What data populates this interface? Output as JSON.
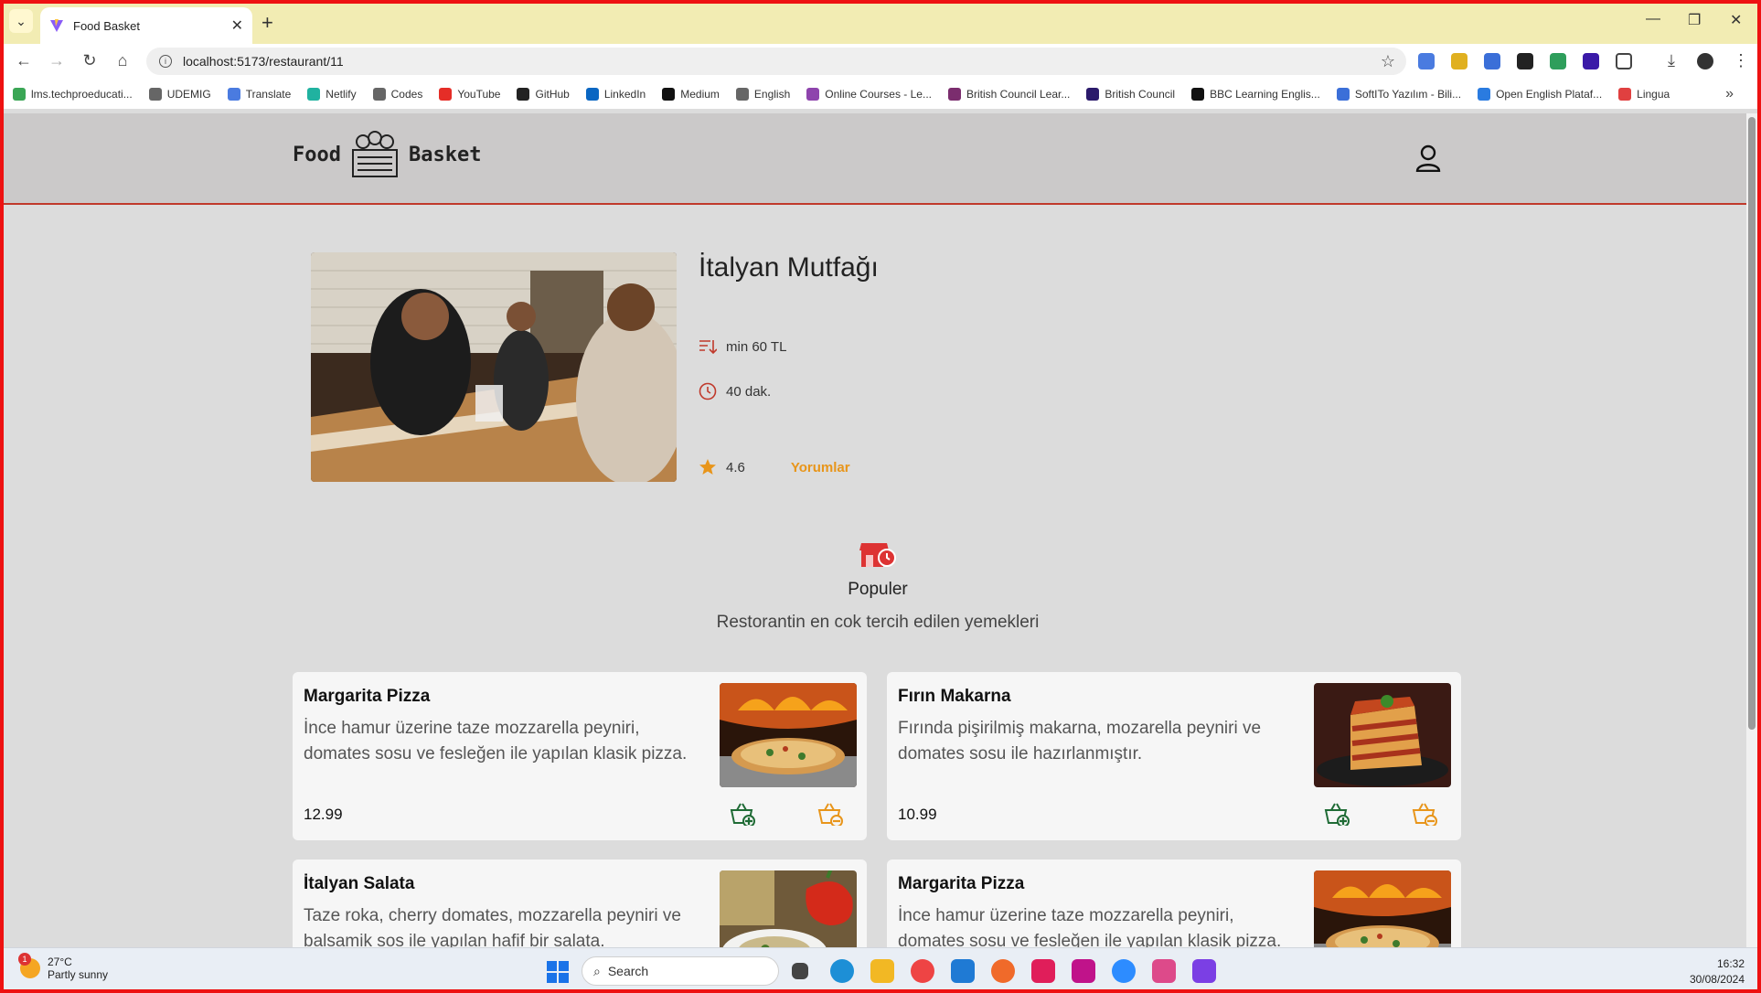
{
  "browser": {
    "tab_title": "Food Basket",
    "url": "localhost:5173/restaurant/11",
    "bookmarks": [
      {
        "label": "lms.techproeducati...",
        "color": "#3aa655"
      },
      {
        "label": "UDEMIG",
        "color": "#666666"
      },
      {
        "label": "Translate",
        "color": "#4a7be0"
      },
      {
        "label": "Netlify",
        "color": "#20b2a0"
      },
      {
        "label": "Codes",
        "color": "#666666"
      },
      {
        "label": "YouTube",
        "color": "#e52d27"
      },
      {
        "label": "GitHub",
        "color": "#222222"
      },
      {
        "label": "LinkedIn",
        "color": "#0a66c2"
      },
      {
        "label": "Medium",
        "color": "#111111"
      },
      {
        "label": "English",
        "color": "#666666"
      },
      {
        "label": "Online Courses - Le...",
        "color": "#8e44ad"
      },
      {
        "label": "British Council Lear...",
        "color": "#7b2d6e"
      },
      {
        "label": "British Council",
        "color": "#2b1a6b"
      },
      {
        "label": "BBC Learning Englis...",
        "color": "#111111"
      },
      {
        "label": "SoftITo Yazılım - Bili...",
        "color": "#3b6fd8"
      },
      {
        "label": "Open English Plataf...",
        "color": "#2a7be0"
      },
      {
        "label": "Lingua",
        "color": "#e04040"
      }
    ]
  },
  "header": {
    "brand_left": "Food",
    "brand_right": "Basket",
    "accent": "#c0392b"
  },
  "restaurant": {
    "name": "İtalyan Mutfağı",
    "min_order": "min 60 TL",
    "delivery_time": "40 dak.",
    "rating": "4.6",
    "reviews_link": "Yorumlar"
  },
  "popular": {
    "title": "Populer",
    "subtitle": "Restorantin en cok tercih edilen yemekleri"
  },
  "menu_items": [
    {
      "name": "Margarita Pizza",
      "desc": "İnce hamur üzerine taze mozzarella peyniri, domates sosu ve fesleğen ile yapılan klasik pizza.",
      "price": "12.99",
      "image": "pizza"
    },
    {
      "name": "Fırın Makarna",
      "desc": "Fırında pişirilmiş makarna, mozarella peyniri ve domates sosu ile hazırlanmıştır.",
      "price": "10.99",
      "image": "lasagna"
    },
    {
      "name": "İtalyan Salata",
      "desc": "Taze roka, cherry domates, mozzarella peyniri ve balsamik sos ile yapılan hafif bir salata.",
      "price": "",
      "image": "salad"
    },
    {
      "name": "Margarita Pizza",
      "desc": "İnce hamur üzerine taze mozzarella peyniri, domates sosu ve fesleğen ile yapılan klasik pizza.",
      "price": "",
      "image": "pizza"
    }
  ],
  "taskbar": {
    "weather_temp": "27°C",
    "weather_desc": "Partly sunny",
    "weather_badge": "1",
    "search_label": "Search",
    "time": "16:32",
    "date": "30/08/2024"
  }
}
